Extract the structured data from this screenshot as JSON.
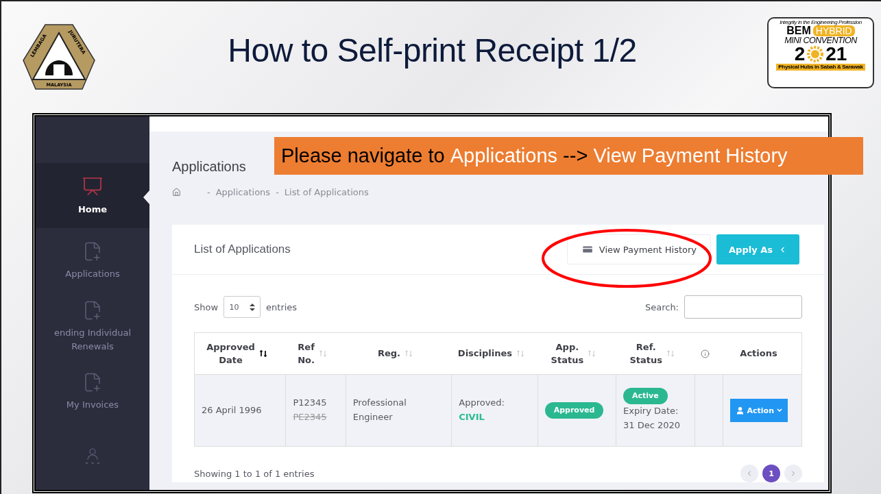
{
  "slide": {
    "title": "How to Self-print Receipt 1/2",
    "left_logo": {
      "top_left": "LEMBAGA",
      "top_right": "JURUTERA",
      "bottom": "MALAYSIA"
    },
    "right_logo": {
      "motto": "Integrity in the Engineering Profession",
      "brand": "BEM",
      "tag": "HYBRID",
      "event": "MINI CONVENTION",
      "year_start": "2",
      "year_end": "21",
      "footer": "Physical Hubs in Sabah & Sarawak"
    }
  },
  "callout": {
    "parts": [
      {
        "text": "Please navigate to ",
        "highlight": false
      },
      {
        "text": "Applications",
        "highlight": true
      },
      {
        "text": " --> ",
        "highlight": false
      },
      {
        "text": "View Payment History",
        "highlight": true
      }
    ]
  },
  "sidebar": {
    "items": [
      {
        "kind": "chart",
        "label": "Home",
        "selected": true
      },
      {
        "kind": "document",
        "label": "Applications",
        "selected": false
      },
      {
        "kind": "document",
        "label": "ending Individual\nRenewals",
        "selected": false
      },
      {
        "kind": "document",
        "label": "My Invoices",
        "selected": false
      },
      {
        "kind": "rating",
        "selected": false
      }
    ]
  },
  "page": {
    "title": "Applications",
    "separator": "-",
    "breadcrumb": [
      "Applications",
      "List of Applications"
    ]
  },
  "card": {
    "title": "List of Applications",
    "secondary_button": "View Payment History",
    "primary_button": "Apply As",
    "show_label": "Show",
    "page_size": "10",
    "entries_label": "entries",
    "search_label": "Search:",
    "columns": [
      {
        "label": "Approved\nDate",
        "sortable": true,
        "sorted": true
      },
      {
        "label": "Ref\nNo.",
        "sortable": true,
        "sorted": false
      },
      {
        "label": "Reg.",
        "sortable": true,
        "sorted": false
      },
      {
        "label": "Disciplines",
        "sortable": true,
        "sorted": false
      },
      {
        "label": "App.\nStatus",
        "sortable": true,
        "sorted": false
      },
      {
        "label": "Ref.\nStatus",
        "sortable": true,
        "sorted": false
      },
      {
        "kind": "info"
      },
      {
        "label": "Actions"
      }
    ],
    "rows": [
      {
        "approved_date": "26 April 1996",
        "ref_no": "P12345",
        "old_ref_no": "PE2345",
        "reg": "Professional\nEngineer",
        "discipline_label": "Approved:",
        "discipline": "CIVIL",
        "app_status": "Approved",
        "ref_status": "Active",
        "expiry": "Expiry Date:\n31 Dec 2020",
        "action": "Action"
      }
    ],
    "footer": "Showing 1 to 1 of 1 entries",
    "pages": [
      {
        "label": "1",
        "selected": true
      }
    ]
  }
}
